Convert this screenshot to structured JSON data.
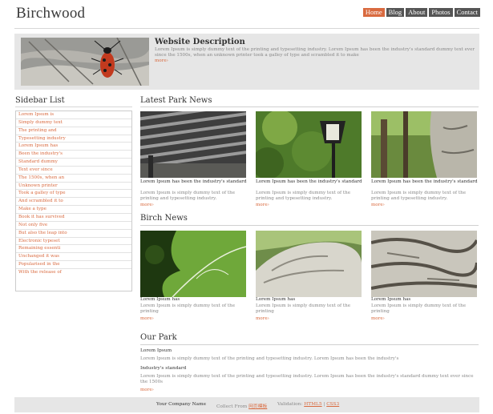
{
  "header": {
    "logo": "Birchwood",
    "nav": [
      "Home",
      "Blog",
      "About",
      "Photos",
      "Contact"
    ]
  },
  "banner": {
    "title": "Website Description",
    "text": "Lorem Ipsum is simply dummy text of the printing and typesetting industry. Lorem Ipsum has been the industry's standard dummy text ever since the 1500s, when an unknown printer took a galley of type and scrambled it to make",
    "more": "more›"
  },
  "sidebar": {
    "title": "Sidebar List",
    "items": [
      "Lorem Ipsum is",
      "Simply dummy text",
      "The printing and",
      "Typesetting industry",
      "Lorem Ipsum has",
      "Been the industry's",
      "Standard dummy",
      "Text ever since",
      "The 1500s, when an",
      "Unknown printer",
      "Took a galley of type",
      "And scrambled it to",
      "Make a type",
      "Book it has survived",
      "Not only five",
      "But also the leap into",
      "Electronic typeset",
      "Remaining essenti",
      "Unchanged it was",
      "Popularised in the",
      "With the release of"
    ]
  },
  "latest": {
    "title": "Latest Park News",
    "cards": [
      {
        "title": "Lorem Ipsum has been the industry's standard",
        "text": "Lorem Ipsum is simply dummy text of the printing and typesetting industry.",
        "more": "more›"
      },
      {
        "title": "Lorem Ipsum has been the industry's standard",
        "text": "Lorem Ipsum is simply dummy text of the printing and typesetting industry.",
        "more": "more›"
      },
      {
        "title": "Lorem Ipsum has been the industry's standard",
        "text": "Lorem Ipsum is simply dummy text of the printing and typesetting industry.",
        "more": "more›"
      }
    ]
  },
  "birch": {
    "title": "Birch News",
    "cards": [
      {
        "title": "Lorem Ipsum has",
        "text": "Lorem Ipsum is simply dummy text of the printing",
        "more": "more›"
      },
      {
        "title": "Lorem Ipsum has",
        "text": "Lorem Ipsum is simply dummy text of the printing",
        "more": "more›"
      },
      {
        "title": "Lorem Ipsum has",
        "text": "Lorem Ipsum is simply dummy text of the printing",
        "more": "more›"
      }
    ]
  },
  "park": {
    "title": "Our Park",
    "h1": "Lorem Ipsum",
    "p1": "Lorem Ipsum is simply dummy text of the printing and typesetting industry. Lorem Ipsum has been the industry's",
    "h2": "Industry's standard",
    "p2": "Lorem Ipsum is simply dummy text of the printing and typesetting industry. Lorem Ipsum has been the industry's standard dummy text ever since the 1500s",
    "more": "more›"
  },
  "footer": {
    "company": "Your Company Name",
    "collect_label": "Collect From",
    "collect_link": "网页模板",
    "validation_label": "Validation:",
    "html5": "HTML5",
    "css3": "CSS3"
  },
  "colors": {
    "accent": "#d96a3f",
    "nav_bg": "#555555",
    "panel": "#e6e6e6"
  }
}
